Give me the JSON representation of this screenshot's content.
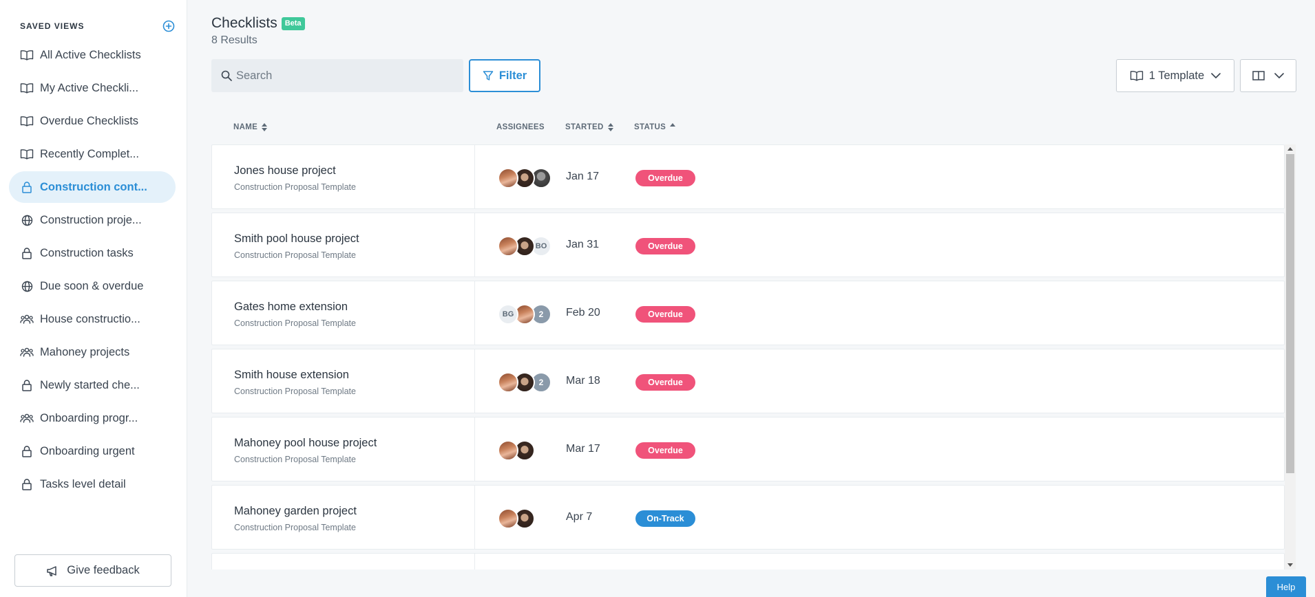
{
  "sidebar": {
    "title": "SAVED VIEWS",
    "add_icon": "plus-circle-icon",
    "items": [
      {
        "label": "All Active Checklists",
        "icon": "book-icon"
      },
      {
        "label": "My Active Checkli...",
        "icon": "book-icon"
      },
      {
        "label": "Overdue Checklists",
        "icon": "book-icon"
      },
      {
        "label": "Recently Complet...",
        "icon": "book-icon"
      },
      {
        "label": "Construction cont...",
        "icon": "lock-icon",
        "active": true
      },
      {
        "label": "Construction proje...",
        "icon": "globe-icon"
      },
      {
        "label": "Construction tasks",
        "icon": "lock-icon"
      },
      {
        "label": "Due soon & overdue",
        "icon": "globe-icon"
      },
      {
        "label": "House constructio...",
        "icon": "users-icon"
      },
      {
        "label": "Mahoney projects",
        "icon": "users-icon"
      },
      {
        "label": "Newly started che...",
        "icon": "lock-icon"
      },
      {
        "label": "Onboarding progr...",
        "icon": "users-icon"
      },
      {
        "label": "Onboarding urgent",
        "icon": "lock-icon"
      },
      {
        "label": "Tasks level detail",
        "icon": "lock-icon"
      }
    ],
    "feedback_label": "Give feedback"
  },
  "header": {
    "title": "Checklists",
    "badge": "Beta",
    "results": "8 Results"
  },
  "toolbar": {
    "search_placeholder": "Search",
    "filter_label": "Filter",
    "template_label": "1 Template"
  },
  "table": {
    "columns": {
      "name": "NAME",
      "assignees": "ASSIGNEES",
      "started": "STARTED",
      "status": "STATUS"
    },
    "rows": [
      {
        "name": "Jones house project",
        "template": "Construction Proposal Template",
        "started": "Jan 17",
        "status": "Overdue",
        "assignees": [
          "woman",
          "man",
          "gray"
        ]
      },
      {
        "name": "Smith pool house project",
        "template": "Construction Proposal Template",
        "started": "Jan 31",
        "status": "Overdue",
        "assignees": [
          "woman",
          "man",
          "BO"
        ]
      },
      {
        "name": "Gates home extension",
        "template": "Construction Proposal Template",
        "started": "Feb 20",
        "status": "Overdue",
        "assignees": [
          "BG",
          "woman",
          "2"
        ]
      },
      {
        "name": "Smith house extension",
        "template": "Construction Proposal Template",
        "started": "Mar 18",
        "status": "Overdue",
        "assignees": [
          "woman",
          "man",
          "2"
        ]
      },
      {
        "name": "Mahoney pool house project",
        "template": "Construction Proposal Template",
        "started": "Mar 17",
        "status": "Overdue",
        "assignees": [
          "woman",
          "man"
        ]
      },
      {
        "name": "Mahoney garden project",
        "template": "Construction Proposal Template",
        "started": "Apr 7",
        "status": "On-Track",
        "assignees": [
          "woman",
          "man"
        ]
      }
    ]
  },
  "colors": {
    "accent": "#2b8ed6",
    "overdue": "#f0537a",
    "on_track": "#2b8ed6",
    "beta": "#3fc89a"
  },
  "help_label": "Help"
}
